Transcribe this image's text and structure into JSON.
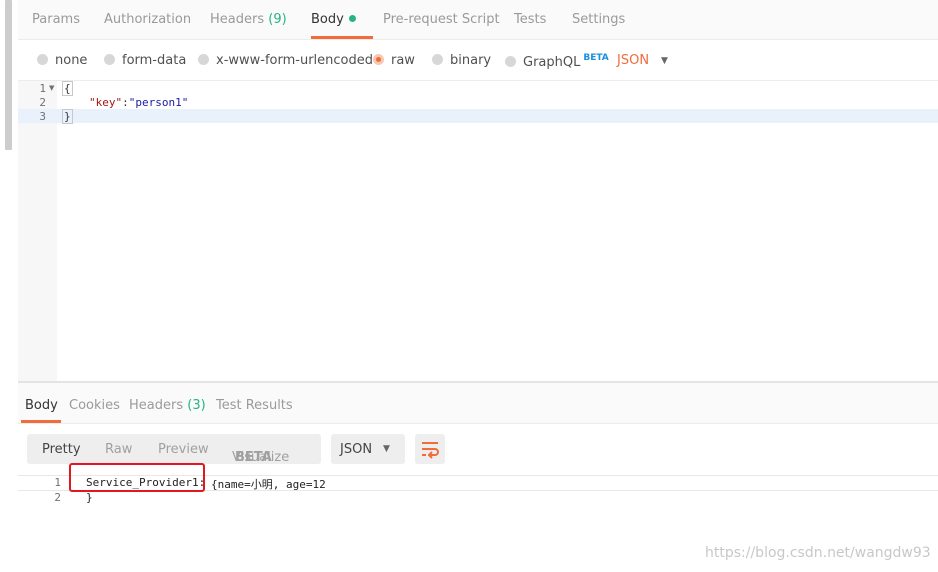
{
  "request_tabs": [
    {
      "label": "Params"
    },
    {
      "label": "Authorization"
    },
    {
      "label": "Headers",
      "count": "(9)"
    },
    {
      "label": "Body"
    },
    {
      "label": "Pre-request Script"
    },
    {
      "label": "Tests"
    },
    {
      "label": "Settings"
    }
  ],
  "body_types": {
    "options": [
      "none",
      "form-data",
      "x-www-form-urlencoded",
      "raw",
      "binary",
      "GraphQL"
    ],
    "selected": "raw",
    "graphql_badge": "BETA",
    "format": "JSON"
  },
  "request_editor": {
    "line_numbers": [
      "1",
      "2",
      "3"
    ],
    "open_brace": "{",
    "key": "\"key\"",
    "colon": ":",
    "value": "\"person1\"",
    "close_brace": "}"
  },
  "response_tabs": [
    {
      "label": "Body"
    },
    {
      "label": "Cookies"
    },
    {
      "label": "Headers",
      "count": "(3)"
    },
    {
      "label": "Test Results"
    }
  ],
  "response_toolbar": {
    "modes": [
      "Pretty",
      "Raw",
      "Preview",
      "Visualize"
    ],
    "visualize_badge": "BETA",
    "format": "JSON"
  },
  "response_body": {
    "line_numbers": [
      "1",
      "2"
    ],
    "line1_part1": "Service_Provider1:",
    "line1_part2": "{name=小明, age=12",
    "line2": "}"
  },
  "watermark": "https://blog.csdn.net/wangdw93",
  "colors": {
    "accent": "#f26b3a",
    "count_green": "#26b47f",
    "beta_blue": "#1a8fe0",
    "highlight_box": "#e4161f"
  }
}
